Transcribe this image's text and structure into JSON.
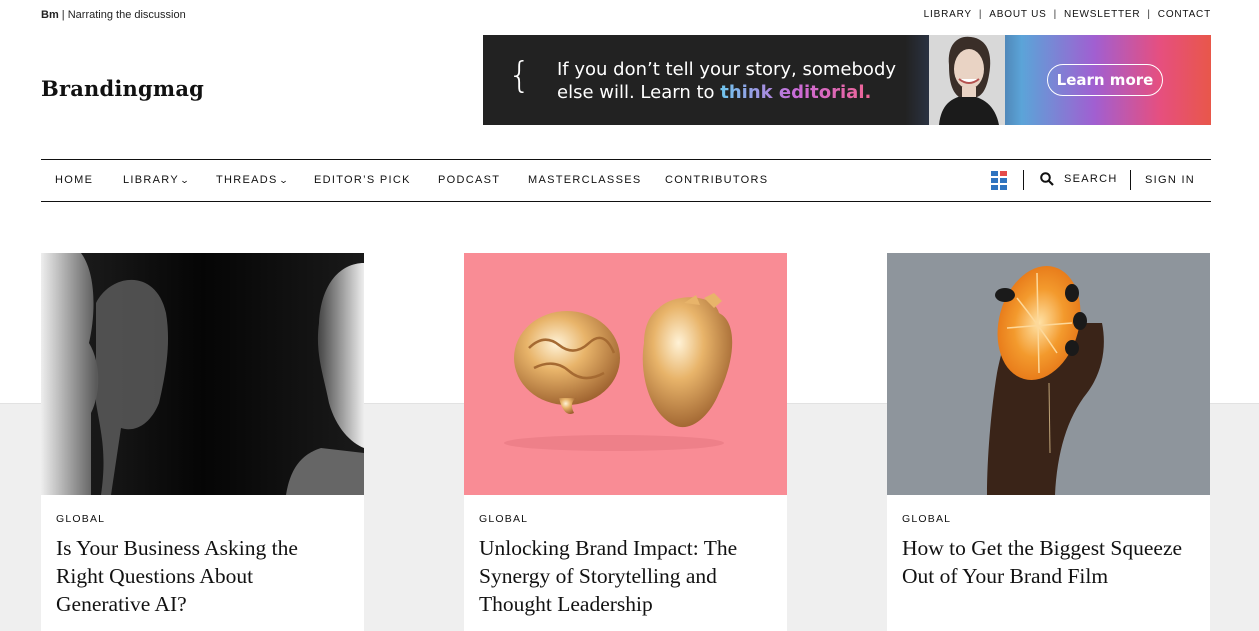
{
  "topbar": {
    "brand_short": "Bm",
    "tagline": "Narrating the discussion",
    "links": [
      "LIBRARY",
      "ABOUT US",
      "NEWSLETTER",
      "CONTACT"
    ]
  },
  "logo": "Brandingmag",
  "banner": {
    "line1": "If you don’t tell your story, somebody",
    "line2_prefix": "else will. Learn to ",
    "line2_highlight": "think editorial.",
    "cta": "Learn more"
  },
  "nav": {
    "items": [
      {
        "label": "HOME",
        "dropdown": false
      },
      {
        "label": "LIBRARY",
        "dropdown": true
      },
      {
        "label": "THREADS",
        "dropdown": true
      },
      {
        "label": "EDITOR’S PICK",
        "dropdown": false
      },
      {
        "label": "PODCAST",
        "dropdown": false
      },
      {
        "label": "MASTERCLASSES",
        "dropdown": false
      },
      {
        "label": "CONTRIBUTORS",
        "dropdown": false
      }
    ],
    "search_label": "SEARCH",
    "signin_label": "SIGN IN"
  },
  "cards": [
    {
      "category": "GLOBAL",
      "title": "Is Your Business Asking the Right Questions About Generative AI?"
    },
    {
      "category": "GLOBAL",
      "title": "Unlocking Brand Impact: The Synergy of Storytelling and Thought Leadership"
    },
    {
      "category": "GLOBAL",
      "title": "How to Get the Biggest Squeeze Out of Your Brand Film"
    }
  ],
  "colors": {
    "banner_dark": "#222222",
    "card2_bg": "#f98c95",
    "card3_bg": "#8e959c",
    "band": "#efefef"
  }
}
